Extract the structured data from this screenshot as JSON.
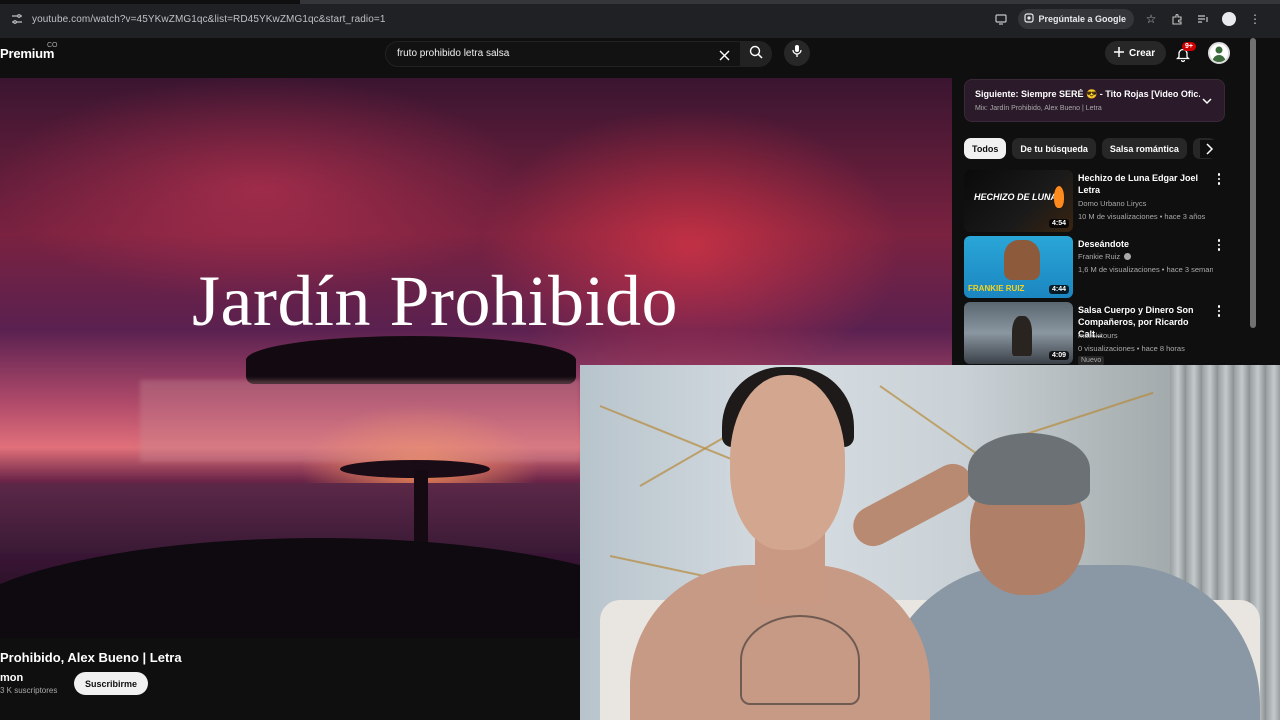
{
  "browser": {
    "url": "youtube.com/watch?v=45YKwZMG1qc&list=RD45YKwZMG1qc&start_radio=1",
    "ask_google": "Pregúntale a Google"
  },
  "header": {
    "logo": "Premium",
    "country": "CO",
    "search_query": "fruto prohibido letra salsa",
    "create_label": "Crear",
    "notifications": "9+"
  },
  "video": {
    "overlay_title": "Jardín Prohibido",
    "page_title": "Prohibido, Alex Bueno | Letra",
    "channel": "mon",
    "subscribers": "3 K suscriptores",
    "subscribe_label": "Suscribirme"
  },
  "up_next": {
    "title": "Siguiente: Siempre SERÉ 😎 - Tito Rojas [Video Ofic...",
    "subtitle": "Mix: Jardín Prohibido, Alex Bueno | Letra"
  },
  "chips": [
    "Todos",
    "De tu búsqueda",
    "Salsa romántica"
  ],
  "recommendations": [
    {
      "title": "Hechizo de Luna Edgar Joel Letra",
      "channel": "Domo Urbano Lirycs",
      "meta": "10 M de visualizaciones • hace 3 años",
      "duration": "4:54",
      "thumb_text": "HECHIZO DE LUNA"
    },
    {
      "title": "Deseándote",
      "channel": "Frankie Ruiz",
      "meta": "1,6 M de visualizaciones • hace 3 seman...",
      "duration": "4:44",
      "thumb_text": "FRANKIE RUIZ"
    },
    {
      "title": "Salsa Cuerpo y Dinero Son Compañeros, por Ricardo Calt...",
      "channel": "maikikitours",
      "meta": "0 visualizaciones • hace 8 horas",
      "duration": "4:09",
      "badge": "Nuevo"
    }
  ],
  "colors": {
    "background": "#0f0f0f",
    "chip_active": "#f1f1f1",
    "notification": "#cc0000",
    "up_next_bg": "#2a1a2a"
  },
  "icons": [
    "tune-icon",
    "cast-icon",
    "star-icon",
    "extensions-icon",
    "media-icon",
    "profile-icon",
    "more-vert-icon",
    "clear-icon",
    "search-icon",
    "mic-icon",
    "plus-icon",
    "bell-icon",
    "chevron-down-icon",
    "chevron-right-icon"
  ]
}
